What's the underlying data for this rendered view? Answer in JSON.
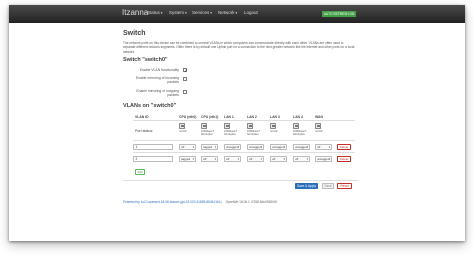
{
  "app": {
    "brand": "Itzanna",
    "menu": [
      {
        "label": "Status"
      },
      {
        "label": "System"
      },
      {
        "label": "Services"
      },
      {
        "label": "Network"
      },
      {
        "label": "Logout"
      }
    ],
    "status_badge": "AUTO REFRESH ON",
    "colors": {
      "navbar": "#2b2b2b",
      "badge": "#43a047",
      "primary": "#2a6ebb",
      "danger": "#c9302c",
      "success": "#5cb85c"
    }
  },
  "page": {
    "title": "Switch",
    "description": "The network ports on this device can be combined to several VLANs in which computers can communicate directly with each other. VLANs are often used to separate different network segments. Often there is by default one Uplink port for a connection to the next greater network like the internet and other ports for a local network."
  },
  "switch_section": {
    "title": "Switch \"switch0\"",
    "options": [
      {
        "label": "Enable VLAN functionality",
        "checked": true
      },
      {
        "label": "Enable mirroring of incoming packets",
        "checked": false
      },
      {
        "label": "Enable mirroring of outgoing packets",
        "checked": false
      }
    ]
  },
  "vlans": {
    "title": "VLANs on \"switch0\"",
    "columns": [
      "VLAN ID",
      "CPU (eth0)",
      "CPU (eth1)",
      "LAN 1",
      "LAN 2",
      "LAN 3",
      "LAN 4",
      "WAN"
    ],
    "port_status_label": "Port status:",
    "port_status": [
      "no link",
      "1000baseT\nfull-duplex",
      "1000baseT\nfull-duplex",
      "1000baseT\nfull-duplex",
      "no link",
      "1000baseT\nfull-duplex",
      "no link",
      "1000baseT\nfull-duplex"
    ],
    "rows": [
      {
        "vlan_id": "1",
        "ports": [
          "off",
          "tagged",
          "untagged",
          "untagged",
          "untagged",
          "untagged",
          "off"
        ],
        "delete_label": "Delete"
      },
      {
        "vlan_id": "2",
        "ports": [
          "tagged",
          "off",
          "off",
          "off",
          "off",
          "off",
          "untagged"
        ],
        "delete_label": "Delete"
      }
    ],
    "add_label": "Add"
  },
  "actions": {
    "save_apply": "Save & Apply",
    "save": "Save",
    "reset": "Reset"
  },
  "footer": {
    "link": "Powered by LuCI openwrt-18.06 branch (git-19.020.41695-8645-f1b1)",
    "version": "OpenWrt 18.06.1 r7258-5eb055306f"
  }
}
